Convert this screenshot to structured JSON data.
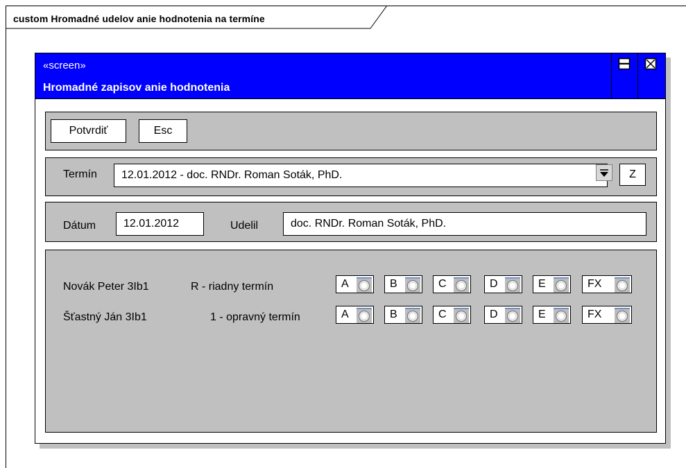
{
  "frame": {
    "title": "custom Hromadné udelov anie hodnotenia na termíne"
  },
  "window": {
    "stereotype": "«screen»",
    "title": "Hromadné zapisov anie hodnotenia",
    "maximize_icon": "maximize-icon",
    "close_icon": "close-icon"
  },
  "toolbar": {
    "confirm_label": "Potvrdiť",
    "esc_label": "Esc"
  },
  "term": {
    "label": "Termín",
    "selected": "12.01.2012 - doc. RNDr. Roman Soták, PhD.",
    "z_label": "Z"
  },
  "details": {
    "date_label": "Dátum",
    "date_value": "12.01.2012",
    "granted_label": "Udelil",
    "granted_value": "doc. RNDr. Roman Soták, PhD."
  },
  "students": [
    {
      "name": "Novák Peter 3Ib1",
      "term": "R - riadny termín"
    },
    {
      "name": "Šťastný Ján 3Ib1",
      "term": "1 - opravný termín"
    }
  ],
  "grades": [
    "A",
    "B",
    "C",
    "D",
    "E",
    "FX"
  ],
  "colors": {
    "titlebar": "#0000ff",
    "panel": "#c0c0c0"
  }
}
